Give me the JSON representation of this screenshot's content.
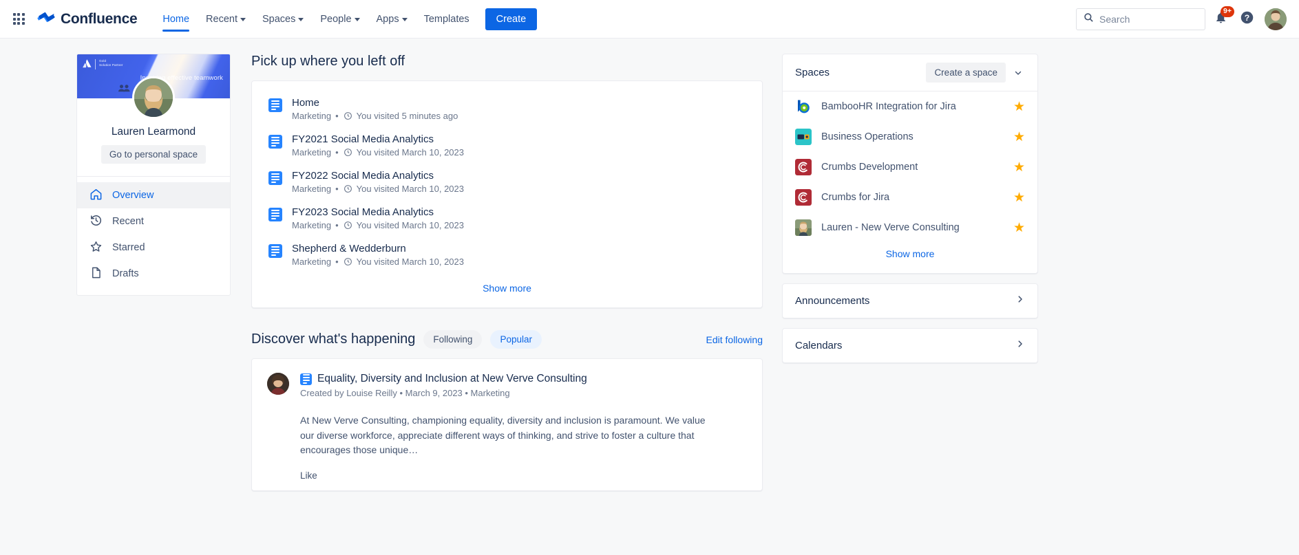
{
  "topnav": {
    "app_switcher": "app-switcher",
    "brand": "Confluence",
    "links": [
      {
        "label": "Home",
        "has_caret": false,
        "active": true
      },
      {
        "label": "Recent",
        "has_caret": true,
        "active": false
      },
      {
        "label": "Spaces",
        "has_caret": true,
        "active": false
      },
      {
        "label": "People",
        "has_caret": true,
        "active": false
      },
      {
        "label": "Apps",
        "has_caret": true,
        "active": false
      },
      {
        "label": "Templates",
        "has_caret": false,
        "active": false
      }
    ],
    "create_label": "Create",
    "search_placeholder": "Search",
    "search_value": "",
    "notification_badge": "9+",
    "help_label": "?"
  },
  "profile": {
    "banner_partner_line1": "Gold",
    "banner_partner_line2": "Solution Partner",
    "banner_tagline": "Inspiring effective teamwork",
    "name": "Lauren Learmond",
    "personal_space_label": "Go to personal space",
    "nav": [
      {
        "label": "Overview",
        "icon": "home-icon",
        "selected": true
      },
      {
        "label": "Recent",
        "icon": "history-icon",
        "selected": false
      },
      {
        "label": "Starred",
        "icon": "star-icon",
        "selected": false
      },
      {
        "label": "Drafts",
        "icon": "page-icon",
        "selected": false
      }
    ]
  },
  "main": {
    "pickup_title": "Pick up where you left off",
    "recent_items": [
      {
        "title": "Home",
        "space": "Marketing",
        "visited": "You visited 5 minutes ago"
      },
      {
        "title": "FY2021 Social Media Analytics",
        "space": "Marketing",
        "visited": "You visited March 10, 2023"
      },
      {
        "title": "FY2022 Social Media Analytics",
        "space": "Marketing",
        "visited": "You visited March 10, 2023"
      },
      {
        "title": "FY2023 Social Media Analytics",
        "space": "Marketing",
        "visited": "You visited March 10, 2023"
      },
      {
        "title": "Shepherd & Wedderburn",
        "space": "Marketing",
        "visited": "You visited March 10, 2023"
      }
    ],
    "show_more": "Show more",
    "discover_title": "Discover what's happening",
    "tabs": [
      {
        "label": "Following",
        "active": false
      },
      {
        "label": "Popular",
        "active": true
      }
    ],
    "edit_following": "Edit following",
    "feed": {
      "title": "Equality, Diversity and Inclusion at New Verve Consulting",
      "meta": "Created by Louise Reilly • March 9, 2023 • Marketing",
      "body": "At New Verve Consulting, championing equality, diversity and inclusion is paramount. We value our diverse workforce, appreciate different ways of thinking, and strive to foster a culture that encourages those unique…",
      "like_label": "Like"
    }
  },
  "right": {
    "spaces_title": "Spaces",
    "create_space_label": "Create a space",
    "spaces": [
      {
        "name": "BambooHR Integration for Jira",
        "icon": "bamboohr-logo",
        "starred": true
      },
      {
        "name": "Business Operations",
        "icon": "business-ops-logo",
        "starred": true
      },
      {
        "name": "Crumbs Development",
        "icon": "crumbs-logo",
        "starred": true
      },
      {
        "name": "Crumbs for Jira",
        "icon": "crumbs-logo",
        "starred": true
      },
      {
        "name": "Lauren - New Verve Consulting",
        "icon": "lauren-avatar",
        "starred": true
      }
    ],
    "spaces_show_more": "Show more",
    "accordions": [
      {
        "label": "Announcements"
      },
      {
        "label": "Calendars"
      }
    ]
  },
  "colors": {
    "brand_blue": "#0C66E4",
    "page_icon_blue": "#2684FF",
    "star_gold": "#FFAB00",
    "badge_red": "#DE350B",
    "bg": "#F7F8F9"
  }
}
